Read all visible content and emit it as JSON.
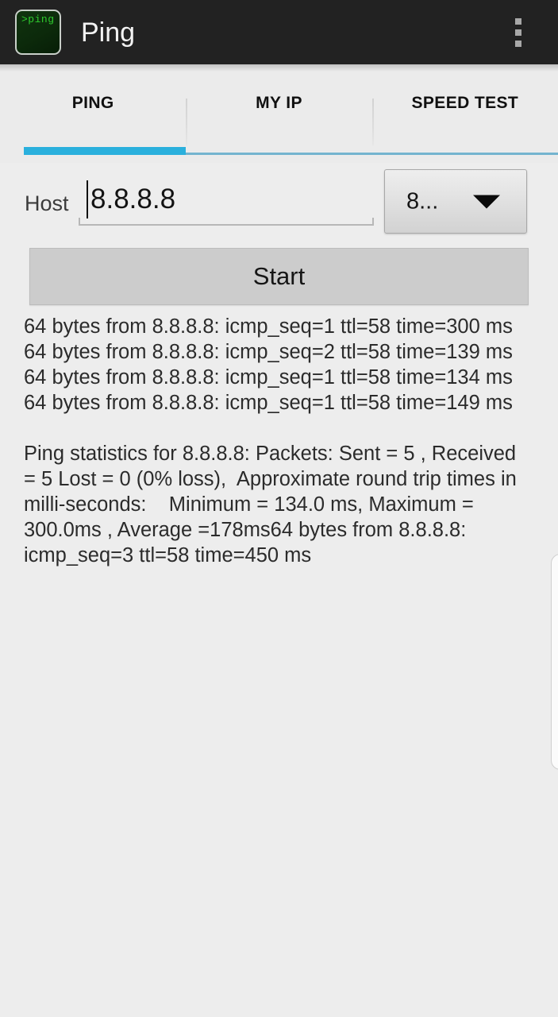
{
  "appbar": {
    "title": "Ping",
    "icon_text": ">ping",
    "icon_name": "app-icon-ping-terminal",
    "overflow_name": "overflow-menu-icon"
  },
  "tabs": [
    {
      "label": "PING",
      "active": true
    },
    {
      "label": "MY IP",
      "active": false
    },
    {
      "label": "SPEED TEST",
      "active": false
    }
  ],
  "host_row": {
    "label": "Host",
    "input_value": "8.8.8.8",
    "input_placeholder": "Host",
    "spinner_value": "8..."
  },
  "start_button": {
    "label": "Start"
  },
  "output": {
    "lines": [
      "64 bytes from 8.8.8.8: icmp_seq=1 ttl=58 time=300 ms",
      "64 bytes from 8.8.8.8: icmp_seq=2 ttl=58 time=139 ms",
      "64 bytes from 8.8.8.8: icmp_seq=1 ttl=58 time=134 ms",
      "64 bytes from 8.8.8.8: icmp_seq=1 ttl=58 time=149 ms"
    ],
    "statistics": "Ping statistics for 8.8.8.8: Packets: Sent = 5 , Received = 5 Lost = 0 (0% loss),  Approximate round trip times in milli-seconds:    Minimum = 134.0 ms, Maximum = 300.0ms , Average =178ms64 bytes from 8.8.8.8: icmp_seq=3 ttl=58 time=450 ms"
  },
  "colors": {
    "appbar_bg": "#222222",
    "accent_active": "#2ab0dd",
    "accent_inactive": "#74b4cf",
    "content_bg": "#ededed",
    "button_bg": "#cccccc",
    "icon_green": "#2ecb2e"
  }
}
